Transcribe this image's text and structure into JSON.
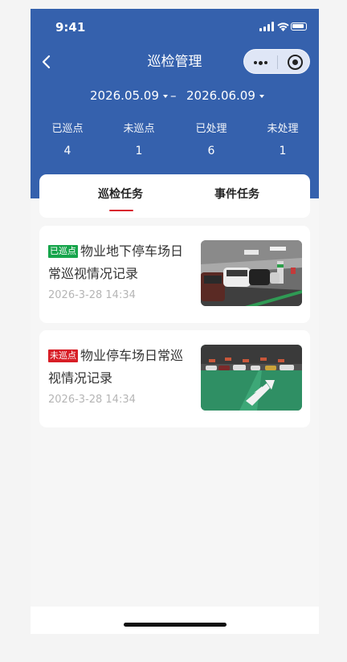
{
  "status_bar": {
    "time": "9:41"
  },
  "nav": {
    "title": "巡检管理",
    "back_icon": "chevron-left-icon",
    "menu_icon": "more-dots-icon",
    "close_icon": "target-icon"
  },
  "date_range": {
    "start": "2026.05.09",
    "separator": "–",
    "end": "2026.06.09"
  },
  "stats": [
    {
      "label": "已巡点",
      "value": "4"
    },
    {
      "label": "未巡点",
      "value": "1"
    },
    {
      "label": "已处理",
      "value": "6"
    },
    {
      "label": "未处理",
      "value": "1"
    }
  ],
  "tabs": [
    {
      "label": "巡检任务",
      "active": true
    },
    {
      "label": "事件任务",
      "active": false
    }
  ],
  "tasks": [
    {
      "status": "已巡点",
      "status_color": "#16a54b",
      "title": "物业地下停车场日常巡视情况记录",
      "time": "2026-3-28 14:34",
      "photo": "parking-garage-photo"
    },
    {
      "status": "未巡点",
      "status_color": "#d81e26",
      "title": "物业停车场日常巡视情况记录",
      "time": "2026-3-28 14:34",
      "photo": "parking-lot-photo"
    }
  ],
  "colors": {
    "header": "#3561ad",
    "accent": "#d9232e",
    "background": "#f6f6f6"
  }
}
